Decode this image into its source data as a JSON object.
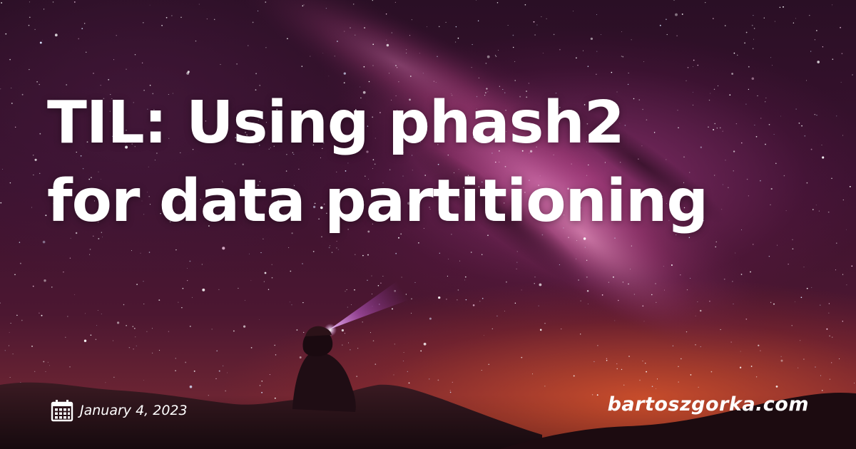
{
  "post": {
    "title_line_1": "TIL: Using phash2",
    "title_line_2": "for data partitioning",
    "date": "January 4, 2023",
    "site": "bartoszgorka.com"
  },
  "icons": {
    "date": "calendar-icon"
  },
  "colors": {
    "text": "#ffffff",
    "sky_dark": "#2a0f25",
    "nebula": "#be4696",
    "horizon_glow": "#e65a28",
    "headlamp_beam": "#c864dc"
  }
}
